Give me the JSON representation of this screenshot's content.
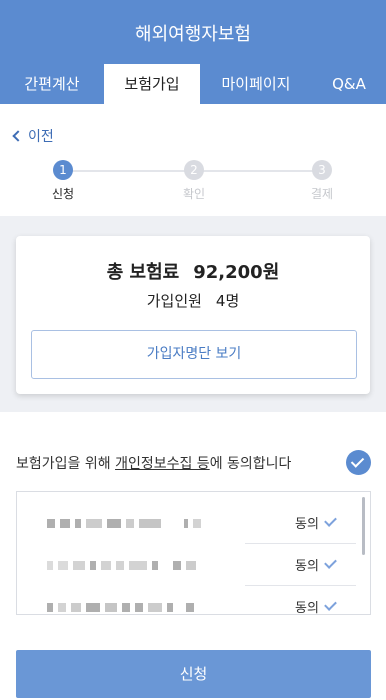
{
  "header": {
    "title": "해외여행자보험"
  },
  "tabs": [
    {
      "label": "간편계산",
      "active": false
    },
    {
      "label": "보험가입",
      "active": true
    },
    {
      "label": "마이페이지",
      "active": false
    },
    {
      "label": "Q&A",
      "active": false
    }
  ],
  "back": {
    "label": "이전"
  },
  "steps": [
    {
      "number": "1",
      "label": "신청",
      "active": true
    },
    {
      "number": "2",
      "label": "확인",
      "active": false
    },
    {
      "number": "3",
      "label": "결제",
      "active": false
    }
  ],
  "summary": {
    "premium_label": "총 보험료",
    "premium_value": "92,200원",
    "members_label": "가입인원",
    "members_value": "4명",
    "list_button": "가입자명단 보기"
  },
  "consent": {
    "text_before": "보험가입을 위해 ",
    "text_link": "개인정보수집 등",
    "text_after": "에 동의합니다",
    "checked": true
  },
  "agreements": [
    {
      "status": "동의"
    },
    {
      "status": "동의"
    },
    {
      "status": "동의"
    }
  ],
  "submit": {
    "label": "신청"
  },
  "colors": {
    "primary": "#5b8bd0",
    "background_gray": "#eef0f4"
  }
}
